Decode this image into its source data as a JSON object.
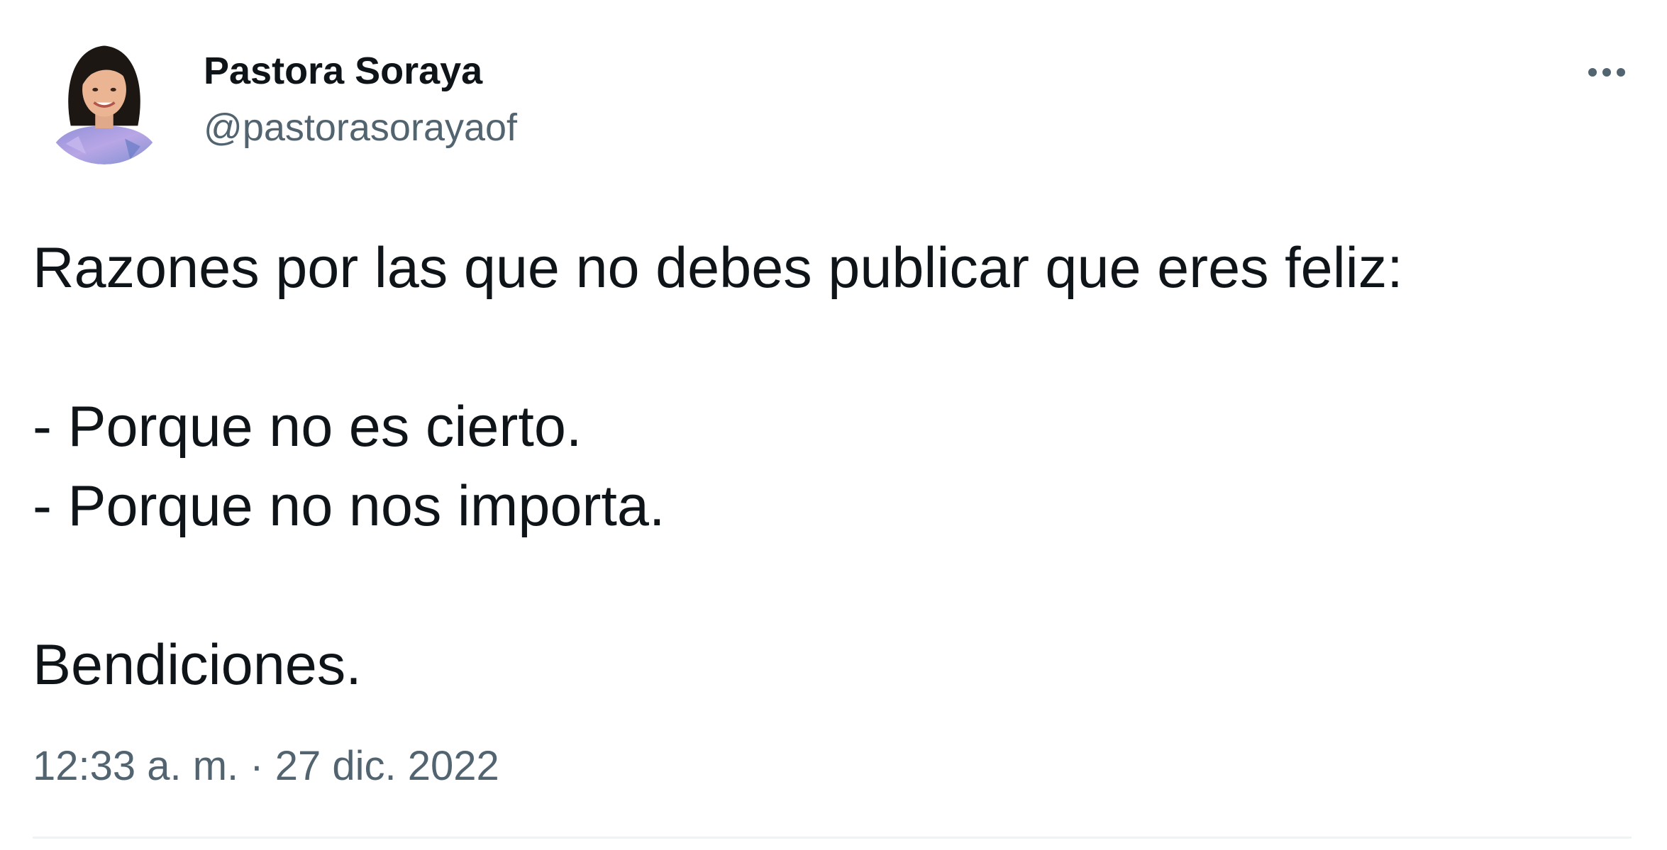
{
  "tweet": {
    "author": {
      "display_name": "Pastora Soraya",
      "handle": "@pastorasorayaof",
      "avatar_icon": "profile-photo-woman"
    },
    "more_icon": "more-horizontal-icon",
    "text_lines": [
      "Razones por las que no debes publicar que eres feliz:",
      "",
      "- Porque no es cierto.",
      "- Porque no nos importa.",
      "",
      "Bendiciones."
    ],
    "time": "12:33 a. m.",
    "separator": " · ",
    "date": "27 dic. 2022"
  },
  "colors": {
    "text_primary": "#0f1419",
    "text_secondary": "#536471",
    "divider": "#eff3f4",
    "background": "#ffffff"
  }
}
